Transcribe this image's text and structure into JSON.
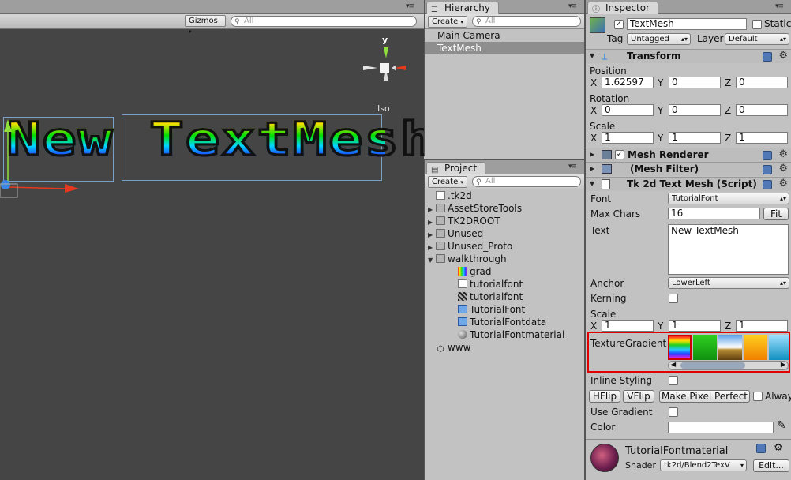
{
  "scene": {
    "toolbar": {
      "gizmos_label": "Gizmos",
      "search_placeholder": "All"
    },
    "gizmo": {
      "axis_label": "y",
      "projection_label": "Iso"
    },
    "render_text": "New TextMesh"
  },
  "hierarchy": {
    "tab_label": "Hierarchy",
    "create_label": "Create",
    "search_placeholder": "All",
    "items": [
      {
        "label": "Main Camera",
        "selected": false
      },
      {
        "label": "TextMesh",
        "selected": true
      }
    ]
  },
  "project": {
    "tab_label": "Project",
    "create_label": "Create",
    "search_placeholder": "All",
    "items": [
      {
        "label": ".tk2d",
        "icon": "file-icon",
        "depth": 0,
        "expander": ""
      },
      {
        "label": "AssetStoreTools",
        "icon": "folder-icon",
        "depth": 0,
        "expander": "▶"
      },
      {
        "label": "TK2DROOT",
        "icon": "folder-icon",
        "depth": 0,
        "expander": "▶"
      },
      {
        "label": "Unused",
        "icon": "folder-icon",
        "depth": 0,
        "expander": "▶"
      },
      {
        "label": "Unused_Proto",
        "icon": "folder-icon",
        "depth": 0,
        "expander": "▶"
      },
      {
        "label": "walkthrough",
        "icon": "folder-icon",
        "depth": 0,
        "expander": "▼"
      },
      {
        "label": "grad",
        "icon": "gradient-texture-icon",
        "depth": 1,
        "expander": ""
      },
      {
        "label": "tutorialfont",
        "icon": "file-icon",
        "depth": 1,
        "expander": ""
      },
      {
        "label": "tutorialfont",
        "icon": "font-texture-icon",
        "depth": 1,
        "expander": ""
      },
      {
        "label": "TutorialFont",
        "icon": "prefab-icon",
        "depth": 1,
        "expander": ""
      },
      {
        "label": "TutorialFontdata",
        "icon": "prefab-icon",
        "depth": 1,
        "expander": ""
      },
      {
        "label": "TutorialFontmaterial",
        "icon": "material-sphere-icon",
        "depth": 1,
        "expander": ""
      },
      {
        "label": "www",
        "icon": "unity-icon",
        "depth": 0,
        "expander": ""
      }
    ]
  },
  "inspector": {
    "tab_label": "Inspector",
    "object_name": "TextMesh",
    "static_label": "Static",
    "tag_label": "Tag",
    "tag_value": "Untagged",
    "layer_label": "Layer",
    "layer_value": "Default",
    "transform": {
      "title": "Transform",
      "position_label": "Position",
      "position": {
        "x": "1.62597",
        "y": "0",
        "z": "0"
      },
      "rotation_label": "Rotation",
      "rotation": {
        "x": "0",
        "y": "0",
        "z": "0"
      },
      "scale_label": "Scale",
      "scale": {
        "x": "1",
        "y": "1",
        "z": "1"
      }
    },
    "axis": {
      "x": "X",
      "y": "Y",
      "z": "Z"
    },
    "mesh_renderer_title": "Mesh Renderer",
    "mesh_filter_title": "(Mesh Filter)",
    "tk2d": {
      "title": "Tk 2d Text Mesh (Script)",
      "font_label": "Font",
      "font_value": "TutorialFont",
      "max_chars_label": "Max Chars",
      "max_chars_value": "16",
      "fit_label": "Fit",
      "text_label": "Text",
      "text_value": "New TextMesh",
      "anchor_label": "Anchor",
      "anchor_value": "LowerLeft",
      "kerning_label": "Kerning",
      "scale_label": "Scale",
      "scale": {
        "x": "1",
        "y": "1",
        "z": "1"
      },
      "texture_gradient_label": "TextureGradient",
      "inline_styling_label": "Inline Styling",
      "hflip_label": "HFlip",
      "vflip_label": "VFlip",
      "make_pixel_perfect_label": "Make Pixel Perfect",
      "always_label": "Alway",
      "use_gradient_label": "Use Gradient",
      "color_label": "Color"
    },
    "material": {
      "name": "TutorialFontmaterial",
      "shader_label": "Shader",
      "shader_value": "tk2d/Blend2TexV",
      "edit_label": "Edit..."
    }
  },
  "colors": {
    "highlight_border": "#e00000",
    "selection": "#8e8e8e",
    "scene_bg": "#454545"
  }
}
